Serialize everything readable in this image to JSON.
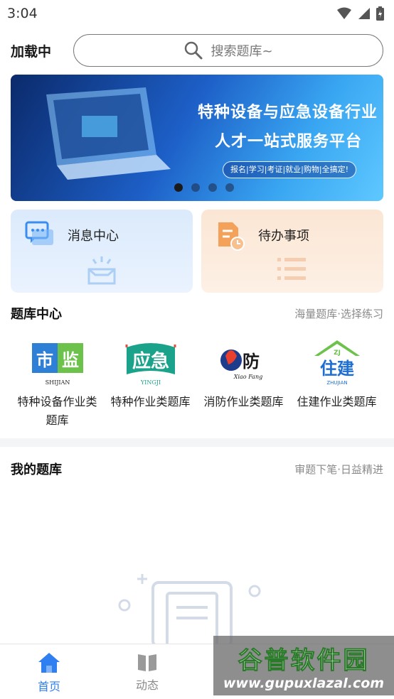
{
  "status": {
    "time": "3:04"
  },
  "header": {
    "loading_text": "加载中",
    "search_placeholder": "搜索题库~"
  },
  "banner": {
    "line1": "特种设备与应急设备行业",
    "line2": "人才一站式服务平台",
    "tagline": "报名|学习|考证|就业|购物|全搞定!",
    "slide_count": 4,
    "active_slide": 1
  },
  "quick_cards": [
    {
      "label": "消息中心",
      "icon": "message-icon"
    },
    {
      "label": "待办事项",
      "icon": "todo-doc-icon"
    }
  ],
  "bank_center": {
    "title": "题库中心",
    "subtitle": "海量题库·选择练习",
    "items": [
      {
        "name": "特种设备作业类题库",
        "logo": "市监",
        "logo_caption": "SHIJIAN"
      },
      {
        "name": "特种作业类题库",
        "logo": "应急",
        "logo_caption": "YINGJI"
      },
      {
        "name": "消防作业类题库",
        "logo": "消防",
        "logo_caption": "Xiao Fang"
      },
      {
        "name": "住建作业类题库",
        "logo": "住建",
        "logo_caption": "ZHUJIAN"
      }
    ]
  },
  "my_bank": {
    "title": "我的题库",
    "subtitle": "审题下笔·日益精进"
  },
  "tabbar": {
    "items": [
      {
        "label": "首页",
        "active": true
      },
      {
        "label": "动态",
        "active": false
      }
    ]
  },
  "watermark": {
    "title": "谷普软件园",
    "url": "www.gupuxlazal.com"
  },
  "colors": {
    "accent": "#2f7ff0",
    "card_blue": "#dbeafc",
    "card_orange": "#fbe6d4"
  }
}
